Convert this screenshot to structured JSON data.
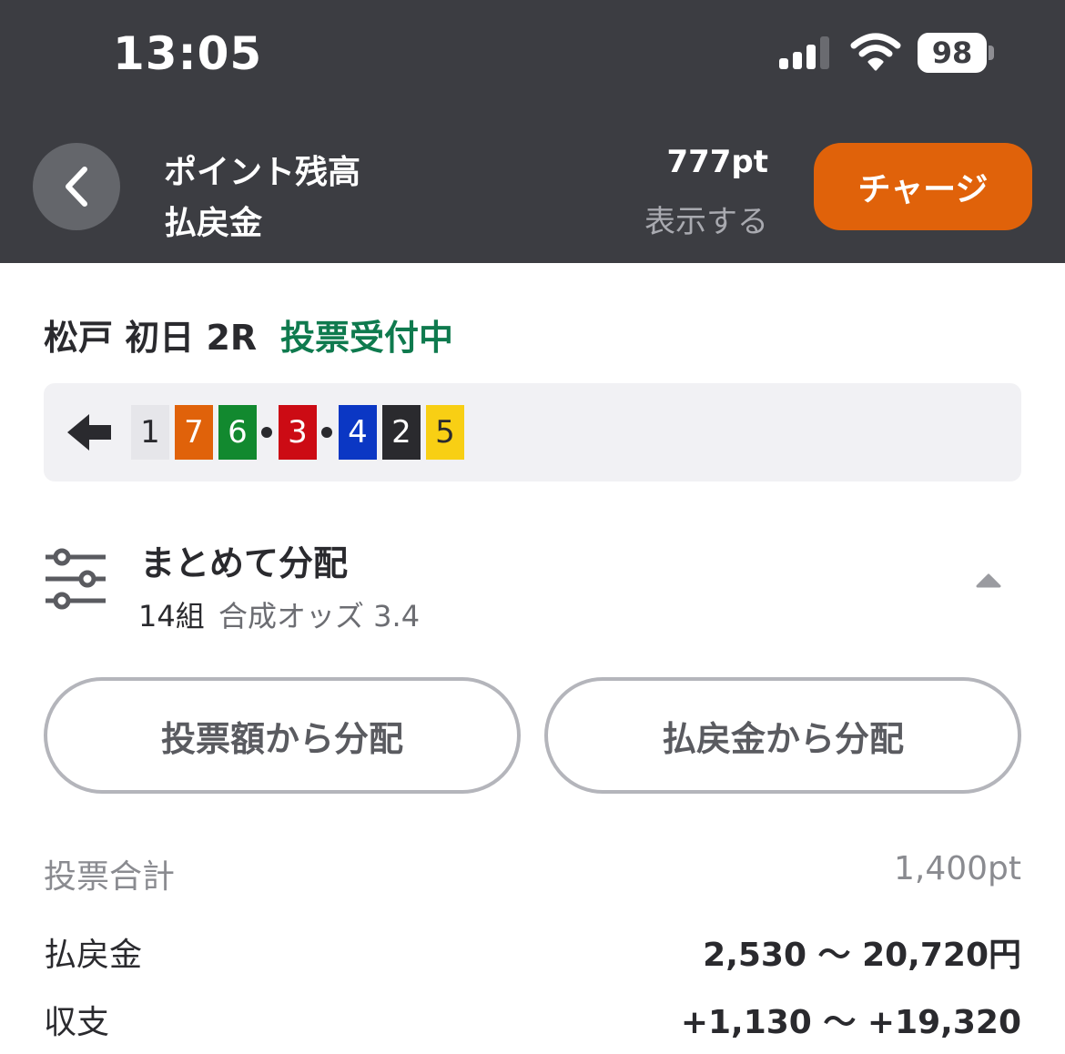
{
  "status_bar": {
    "time": "13:05",
    "battery": "98"
  },
  "header": {
    "label_points": "ポイント残高",
    "label_refund": "払戻金",
    "points_value": "777pt",
    "show_label": "表示する",
    "charge_label": "チャージ",
    "accent_color": "#e0620a"
  },
  "race": {
    "title": "松戸 初日 2R",
    "status": "投票受付中",
    "status_color": "#0f7a4e"
  },
  "lineup": [
    {
      "number": "1",
      "bg": "#e6e6ea",
      "fg": "#2a2a2e"
    },
    {
      "number": "7",
      "bg": "#e0620a",
      "fg": "#ffffff"
    },
    {
      "number": "6",
      "bg": "#12892f",
      "fg": "#ffffff"
    },
    {
      "number": "3",
      "bg": "#cc0b14",
      "fg": "#ffffff"
    },
    {
      "number": "4",
      "bg": "#0b37c4",
      "fg": "#ffffff"
    },
    {
      "number": "2",
      "bg": "#2a2a2e",
      "fg": "#ffffff"
    },
    {
      "number": "5",
      "bg": "#f8cf14",
      "fg": "#2a2a2e"
    }
  ],
  "distribution": {
    "title": "まとめて分配",
    "count": "14組",
    "odds": "合成オッズ 3.4",
    "btn_by_amount": "投票額から分配",
    "btn_by_refund": "払戻金から分配"
  },
  "summary": {
    "total_label": "投票合計",
    "total_value": "1,400pt",
    "refund_label": "払戻金",
    "refund_value": "2,530 〜 20,720円",
    "balance_label": "収支",
    "balance_value": "+1,130 〜 +19,320"
  }
}
